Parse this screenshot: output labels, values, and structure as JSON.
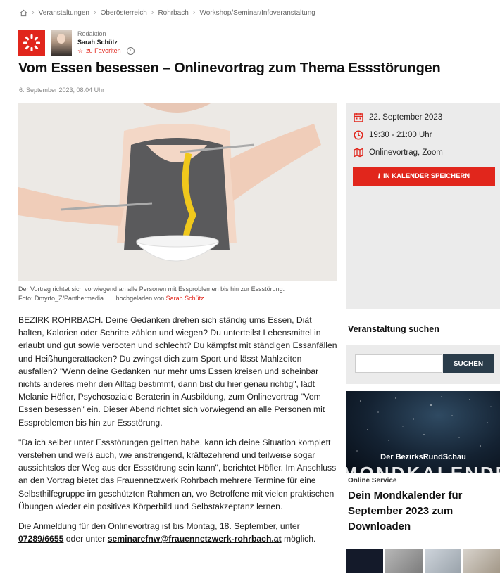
{
  "breadcrumb": {
    "items": [
      "Veranstaltungen",
      "Oberösterreich",
      "Rohrbach",
      "Workshop/Seminar/Infoveranstaltung"
    ]
  },
  "author": {
    "role": "Redaktion",
    "name": "Sarah Schütz",
    "favorite_label": "zu Favoriten"
  },
  "article": {
    "title": "Vom Essen besessen – Onlinevortrag zum Thema Essstörungen",
    "date": "6. September 2023, 08:04 Uhr",
    "caption": "Der Vortrag richtet sich vorwiegend an alle Personen mit Essproblemen bis hin zur Essstörung.",
    "photo_credit": "Foto: Dmyrto_Z/Panthermedia",
    "uploaded_by_label": "hochgeladen von",
    "uploader": "Sarah Schütz",
    "paragraph1": "BEZIRK ROHRBACH. Deine Gedanken drehen sich ständig ums Essen, Diät halten, Kalorien oder Schritte zählen und wiegen? Du unterteilst Lebens­mittel in erlaubt und gut sowie verboten und schlecht? Du kämpfst mit ständigen Essanfällen und Heißhungerattacken? Du zwingst dich zum Sport und lässt Mahlzeiten ausfallen? \"Wenn deine Gedanken nur mehr ums Essen kreisen und scheinbar nichts anderes mehr den Alltag be­stimmt, dann bist du hier genau richtig\", lädt Melanie Höfler, Psychoso­ziale Beraterin in Ausbildung, zum Onlinevortrag \"Vom Essen besessen\" ein. Dieser Abend richtet sich vorwiegend an alle Personen mit Esspro­blemen bis hin zur Essstörung.",
    "paragraph2": "\"Da ich selber unter Essstörungen gelitten habe, kann ich deine Situation komplett verstehen und weiß auch, wie anstrengend, kräftezehrend und teilweise sogar aussichtslos der Weg aus der Essstörung sein kann\", be­richtet Höfler. Im Anschluss an den Vortrag bietet das Frauennetzwerk Rohrbach mehrere Termine für eine Selbsthilfegruppe im geschützten Rahmen an, wo Betroffene mit vielen praktischen Übungen wieder ein positives Körperbild und Selbstakzeptanz lernen.",
    "p3_text": "Die Anmeldung für den Onlinevortrag ist bis Montag, 18. September, unter",
    "phone": "07289/6655",
    "or_label": "oder unter",
    "email": "seminarefnw@frauennetzwerk-rohrbach.at",
    "p3_end": "möglich."
  },
  "event": {
    "date": "22. September 2023",
    "time": "19:30 - 21:00 Uhr",
    "location": "Onlinevortrag, Zoom",
    "calendar_button": "IN KALENDER SPEICHERN"
  },
  "search": {
    "title": "Veranstaltung suchen",
    "placeholder": "",
    "button": "SUCHEN"
  },
  "promo": {
    "brand": "Der BezirksRundSchau",
    "image_text": "MONDKALENDER",
    "kicker": "Online Service",
    "title": "Dein Mondkalender für September 2023 zum Downloaden"
  },
  "colors": {
    "accent": "#e1261c",
    "search_button": "#2a3c4a",
    "sidebar_bg": "#ebebeb"
  }
}
